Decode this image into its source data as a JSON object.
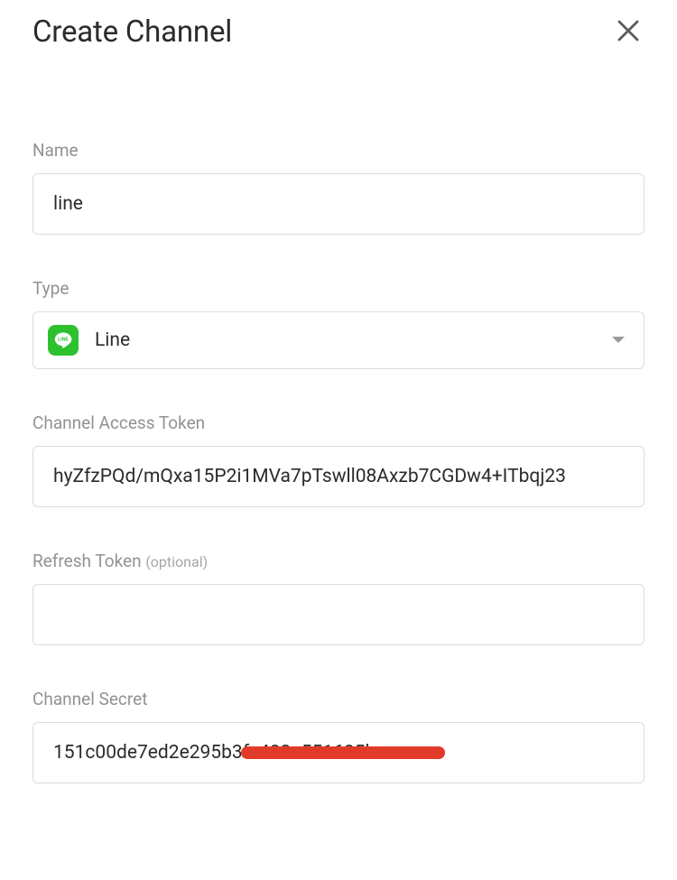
{
  "header": {
    "title": "Create Channel"
  },
  "fields": {
    "name": {
      "label": "Name",
      "value": "line"
    },
    "type": {
      "label": "Type",
      "value": "Line"
    },
    "access_token": {
      "label": "Channel Access Token",
      "value": "hyZfzPQd/mQxa15P2i1MVa7pTswll08Axzb7CGDw4+ITbqj23"
    },
    "refresh_token": {
      "label": "Refresh Token",
      "optional_text": "(optional)",
      "value": ""
    },
    "channel_secret": {
      "label": "Channel Secret",
      "value": "151c00de7ed2e295b3fe402a551605ba"
    }
  }
}
